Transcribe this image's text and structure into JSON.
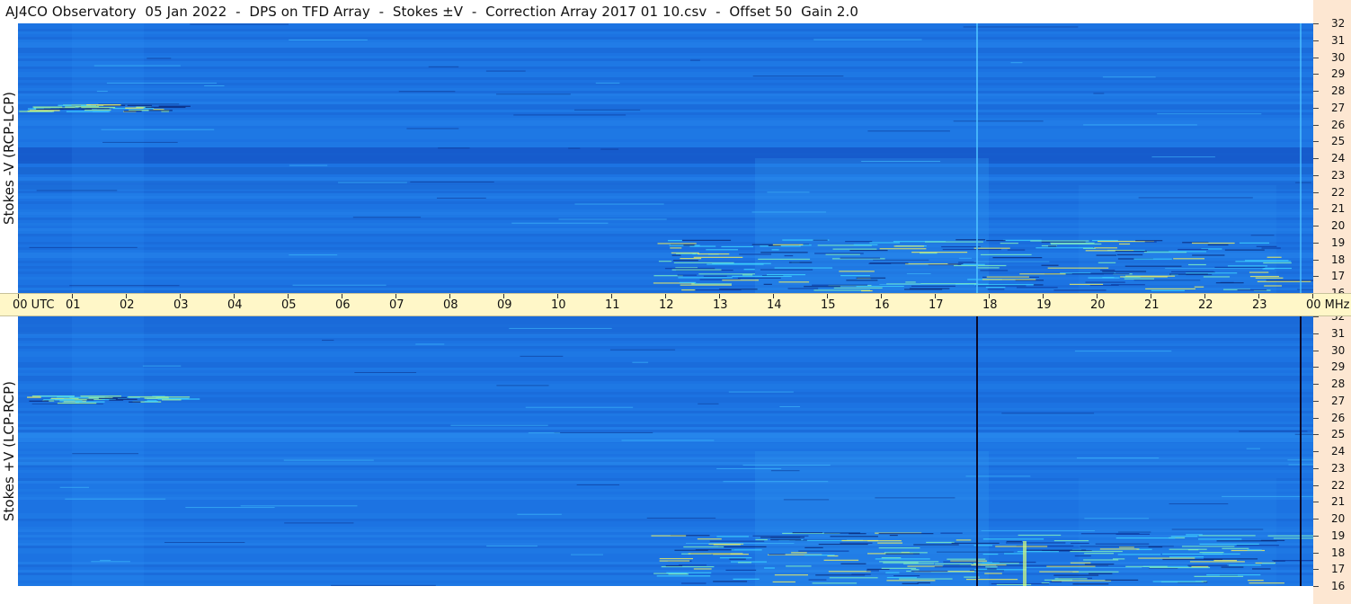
{
  "title": "AJ4CO Observatory  05 Jan 2022  -  DPS on TFD Array  -  Stokes ±V  -  Correction Array 2017 01 10.csv  -  Offset 50  Gain 2.0",
  "panels": {
    "top_label": "Stokes -V (RCP-LCP)",
    "bottom_label": "Stokes +V (LCP-RCP)"
  },
  "time_axis": {
    "labels": [
      "00  UTC",
      "01",
      "02",
      "03",
      "04",
      "05",
      "06",
      "07",
      "08",
      "09",
      "10",
      "11",
      "12",
      "13",
      "14",
      "15",
      "16",
      "17",
      "18",
      "19",
      "20",
      "21",
      "22",
      "23",
      "00 MHz"
    ]
  },
  "frequency_axis": {
    "labels": [
      "32",
      "31",
      "30",
      "29",
      "28",
      "27",
      "26",
      "25",
      "24",
      "23",
      "22",
      "21",
      "20",
      "19",
      "18",
      "17",
      "16"
    ]
  },
  "colors": {
    "spectrogram_base": "#1a73e8",
    "time_axis_bg": "#fff7c8",
    "freq_axis_bg": "#fde7d2"
  }
}
